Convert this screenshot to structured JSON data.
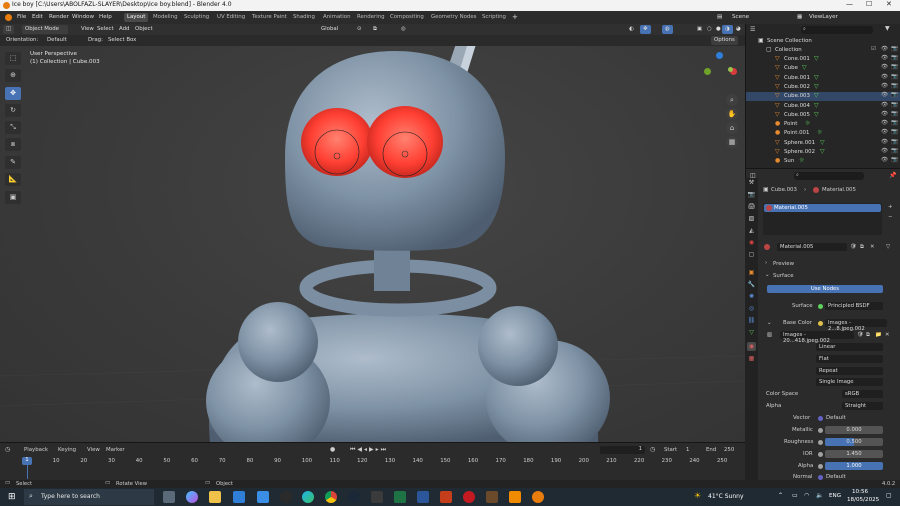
{
  "window": {
    "title": "Ice boy [C:\\Users\\ABOLFAZL-SLAYER\\Desktop\\Ice boy.blend] - Blender 4.0"
  },
  "menu": [
    "File",
    "Edit",
    "Render",
    "Window",
    "Help"
  ],
  "workspaces": [
    "Layout",
    "Modeling",
    "Sculpting",
    "UV Editing",
    "Texture Paint",
    "Shading",
    "Animation",
    "Rendering",
    "Compositing",
    "Geometry Nodes",
    "Scripting"
  ],
  "scene": {
    "scene_label": "Scene",
    "viewlayer_label": "ViewLayer"
  },
  "viewport_header": {
    "mode": "Object Mode",
    "view": "View",
    "select": "Select",
    "add": "Add",
    "object": "Object",
    "transform": "Global",
    "orientation_label": "Orientation:",
    "orientation_value": "Default",
    "drag_label": "Drag:",
    "drag_value": "Select Box",
    "options": "Options"
  },
  "viewport": {
    "perspective": "User Perspective",
    "collection": "(1) Collection | Cube.003"
  },
  "outliner": {
    "root": "Scene Collection",
    "collection": "Collection",
    "items": [
      {
        "name": "Cone.001",
        "icon": "cone"
      },
      {
        "name": "Cube",
        "icon": "mesh"
      },
      {
        "name": "Cube.001",
        "icon": "mesh"
      },
      {
        "name": "Cube.002",
        "icon": "mesh"
      },
      {
        "name": "Cube.003",
        "icon": "mesh"
      },
      {
        "name": "Cube.004",
        "icon": "mesh"
      },
      {
        "name": "Cube.005",
        "icon": "mesh"
      },
      {
        "name": "Point",
        "icon": "light"
      },
      {
        "name": "Point.001",
        "icon": "light"
      },
      {
        "name": "Sphere.001",
        "icon": "mesh"
      },
      {
        "name": "Sphere.002",
        "icon": "mesh"
      },
      {
        "name": "Sun",
        "icon": "light"
      }
    ]
  },
  "properties": {
    "breadcrumb_object": "Cube.003",
    "breadcrumb_material": "Material.005",
    "slot": "Material.005",
    "material_name": "Material.005",
    "preview": "Preview",
    "surface": "Surface",
    "use_nodes": "Use Nodes",
    "surface_label": "Surface",
    "surface_value": "Principled BSDF",
    "base_color_label": "Base Color",
    "base_color_value": "Images - 2...8.jpeg.002",
    "image_name": "Images - 20...418.jpeg.002",
    "interpolation": "Linear",
    "projection": "Flat",
    "extension": "Repeat",
    "source": "Single Image",
    "color_space_label": "Color Space",
    "color_space_value": "sRGB",
    "alpha_label": "Alpha",
    "alpha_value": "Straight",
    "vector_label": "Vector",
    "vector_value": "Default",
    "metallic_label": "Metallic",
    "metallic_value": "0.000",
    "roughness_label": "Roughness",
    "roughness_value": "0.500",
    "ior_label": "IOR",
    "ior_value": "1.450",
    "alpha2_label": "Alpha",
    "alpha2_value": "1.000",
    "normal_label": "Normal",
    "normal_value": "Default"
  },
  "timeline": {
    "playback": "Playback",
    "keying": "Keying",
    "view": "View",
    "marker": "Marker",
    "current_frame": "1",
    "start_label": "Start",
    "start_value": "1",
    "end_label": "End",
    "end_value": "250",
    "ticks": [
      "0",
      "10",
      "20",
      "30",
      "40",
      "50",
      "60",
      "70",
      "80",
      "90",
      "100",
      "110",
      "120",
      "130",
      "140",
      "150",
      "160",
      "170",
      "180",
      "190",
      "200",
      "210",
      "220",
      "230",
      "240",
      "250"
    ],
    "current": "1"
  },
  "statusbar": {
    "select": "Select",
    "rotate": "Rotate View",
    "object": "Object",
    "version": "4.0.2"
  },
  "taskbar": {
    "search_placeholder": "Type here to search",
    "weather": "41°C  Sunny",
    "lang": "ENG",
    "time": "10:56",
    "date": "18/05/2025"
  },
  "colors": {
    "accent": "#4772b3",
    "eyes": "#ff4a3a",
    "ice": "#8c9fb0"
  }
}
